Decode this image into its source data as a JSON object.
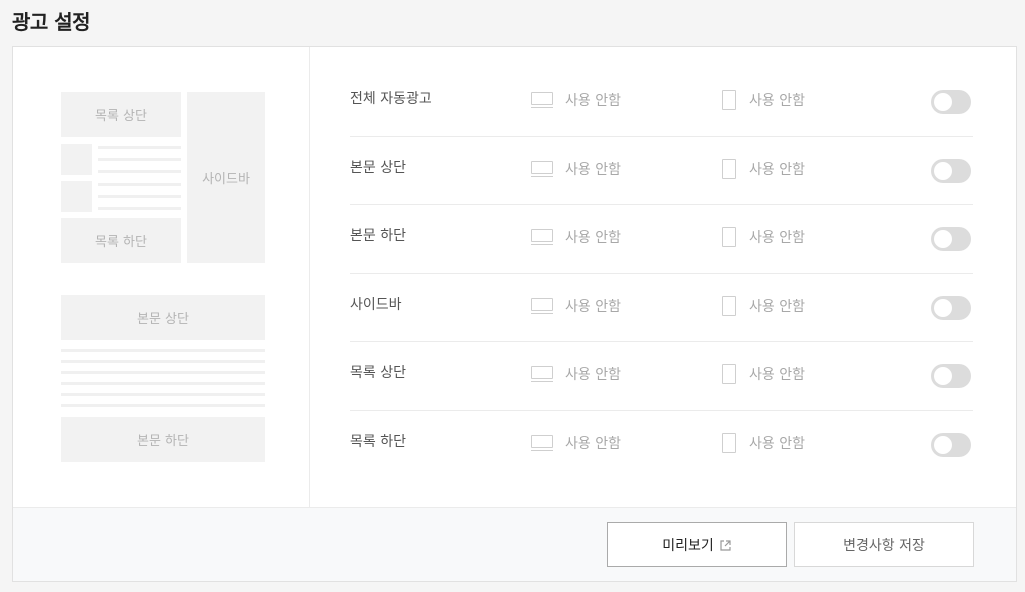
{
  "page": {
    "title": "광고 설정"
  },
  "preview": {
    "list_top": "목록 상단",
    "list_bottom": "목록 하단",
    "sidebar": "사이드바",
    "body_top": "본문 상단",
    "body_bottom": "본문 하단"
  },
  "settings": {
    "rows": [
      {
        "label": "전체 자동광고",
        "pc_status": "사용 안함",
        "mobile_status": "사용 안함",
        "enabled": false
      },
      {
        "label": "본문 상단",
        "pc_status": "사용 안함",
        "mobile_status": "사용 안함",
        "enabled": false
      },
      {
        "label": "본문 하단",
        "pc_status": "사용 안함",
        "mobile_status": "사용 안함",
        "enabled": false
      },
      {
        "label": "사이드바",
        "pc_status": "사용 안함",
        "mobile_status": "사용 안함",
        "enabled": false
      },
      {
        "label": "목록 상단",
        "pc_status": "사용 안함",
        "mobile_status": "사용 안함",
        "enabled": false
      },
      {
        "label": "목록 하단",
        "pc_status": "사용 안함",
        "mobile_status": "사용 안함",
        "enabled": false
      }
    ]
  },
  "footer": {
    "preview_label": "미리보기",
    "save_label": "변경사항 저장"
  },
  "icons": {
    "pc": "desktop-icon",
    "mobile": "mobile-icon",
    "external": "external-link-icon"
  },
  "colors": {
    "toggle_off": "#dcdcdc",
    "placeholder": "#f2f2f2",
    "muted_text": "#a8a8a8"
  }
}
